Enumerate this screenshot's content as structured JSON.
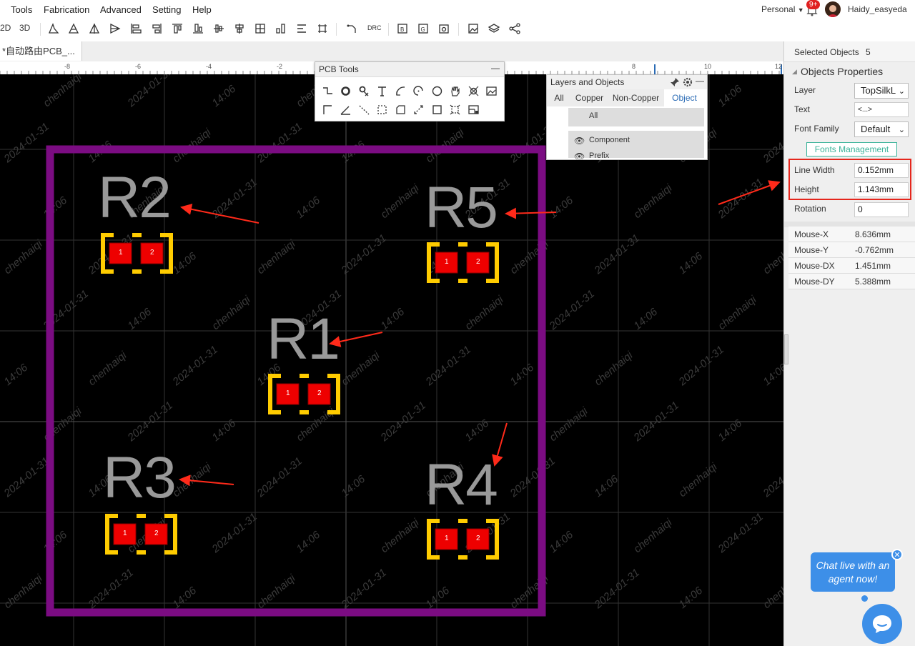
{
  "menu": {
    "items": [
      "Tools",
      "Fabrication",
      "Advanced",
      "Setting",
      "Help"
    ],
    "account": "Personal",
    "notification_badge": "9+",
    "username": "Haidy_easyeda"
  },
  "toolbar": {
    "view_2d": "2D",
    "view_3d": "3D",
    "drc": "DRC",
    "icons": [
      "align-left-icon",
      "align-right-icon",
      "align-top-icon",
      "align-bottom-icon",
      "align-h-center-icon",
      "align-v-center-icon",
      "distribute-h-icon",
      "distribute-v-icon",
      "grid-align-icon",
      "route-icon",
      "board-outline-icon",
      "gerber-icon",
      "photo-icon",
      "image-icon",
      "layers-icon",
      "share-icon"
    ]
  },
  "tabs": {
    "document": "*自动路由PCB_..."
  },
  "ruler": {
    "labels": [
      "-8",
      "-6",
      "-4",
      "-2",
      "8",
      "10",
      "12"
    ]
  },
  "pcb_tools": {
    "title": "PCB Tools",
    "minimize": "—"
  },
  "layers_panel": {
    "title": "Layers and Objects",
    "tabs": [
      "All",
      "Copper",
      "Non-Copper",
      "Object"
    ],
    "active_tab": "Object",
    "rows": [
      "All",
      "Component",
      "Prefix"
    ]
  },
  "properties": {
    "selected_label": "Selected Objects",
    "selected_count": "5",
    "section_title": "Objects Properties",
    "layer_label": "Layer",
    "layer_value": "TopSilkL",
    "text_label": "Text",
    "text_value": "<...>",
    "font_family_label": "Font Family",
    "font_family_value": "Default",
    "fonts_button": "Fonts Management",
    "line_width_label": "Line Width",
    "line_width_value": "0.152mm",
    "height_label": "Height",
    "height_value": "1.143mm",
    "rotation_label": "Rotation",
    "rotation_value": "0",
    "mouse": [
      {
        "key": "Mouse-X",
        "value": "8.636mm"
      },
      {
        "key": "Mouse-Y",
        "value": "-0.762mm"
      },
      {
        "key": "Mouse-DX",
        "value": "1.451mm"
      },
      {
        "key": "Mouse-DY",
        "value": "5.388mm"
      }
    ]
  },
  "pcb": {
    "components": [
      {
        "ref": "R2",
        "pad1": "1",
        "pad2": "2"
      },
      {
        "ref": "R5",
        "pad1": "1",
        "pad2": "2"
      },
      {
        "ref": "R1",
        "pad1": "1",
        "pad2": "2"
      },
      {
        "ref": "R3",
        "pad1": "1",
        "pad2": "2"
      },
      {
        "ref": "R4",
        "pad1": "1",
        "pad2": "2"
      }
    ],
    "watermarks": [
      "chenhaiqi",
      "2024-01-31",
      "14:06"
    ],
    "colors": {
      "outline": "#7b0c82",
      "silk": "#999999",
      "pad": "#ee0000",
      "silk_box": "#ffcc00",
      "annotation": "#ff2a1a"
    }
  },
  "chat": {
    "message": "Chat live with an agent now!",
    "close": "✕"
  }
}
